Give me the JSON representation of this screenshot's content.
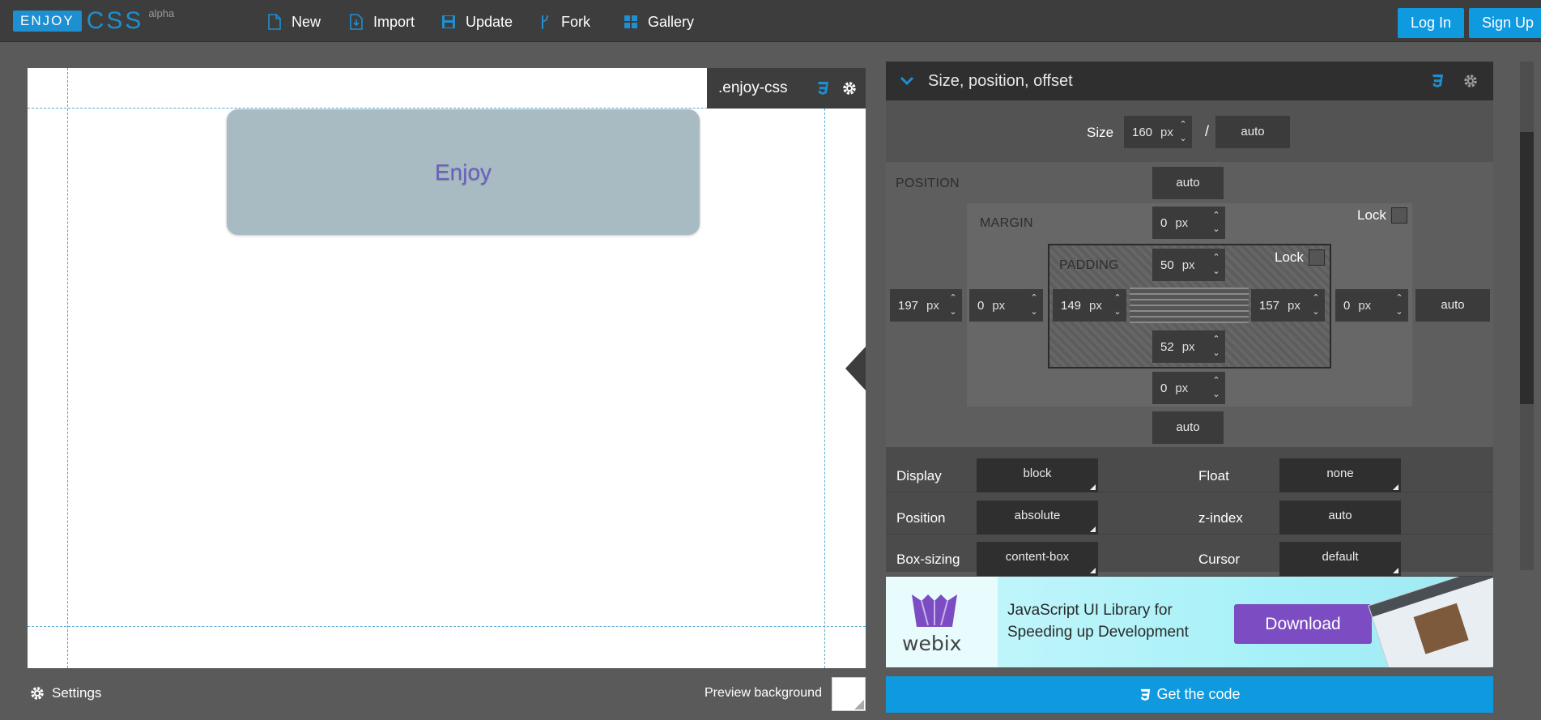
{
  "logo": {
    "enjoy": "ENJOY",
    "css": "CSS",
    "alpha": "alpha"
  },
  "nav": {
    "new": "New",
    "import": "Import",
    "update": "Update",
    "fork": "Fork",
    "gallery": "Gallery"
  },
  "auth": {
    "login": "Log In",
    "signup": "Sign Up"
  },
  "preview": {
    "class_name": ".enjoy-css",
    "element_text": "Enjoy"
  },
  "bottom": {
    "settings": "Settings",
    "preview_background": "Preview background",
    "get_code": "Get the code"
  },
  "panel": {
    "title": "Size, position, offset",
    "size": {
      "label": "Size",
      "width": "160",
      "width_unit": "px",
      "height": "auto",
      "separator": "/"
    },
    "position": {
      "label": "POSITION",
      "top": "auto",
      "bottom": "auto",
      "right": "auto",
      "left": "197",
      "left_unit": "px"
    },
    "margin": {
      "label": "MARGIN",
      "lock": "Lock",
      "top": "0",
      "bottom": "0",
      "left": "0",
      "right": "0",
      "unit": "px"
    },
    "padding": {
      "label": "PADDING",
      "lock": "Lock",
      "top": "50",
      "bottom": "52",
      "left": "149",
      "right": "157",
      "unit": "px"
    },
    "props": {
      "display_label": "Display",
      "display": "block",
      "float_label": "Float",
      "float": "none",
      "position_label": "Position",
      "position": "absolute",
      "zindex_label": "z-index",
      "zindex": "auto",
      "boxsizing_label": "Box-sizing",
      "boxsizing": "content-box",
      "cursor_label": "Cursor",
      "cursor": "default"
    }
  },
  "ad": {
    "brand": "webix",
    "line1": "JavaScript UI Library for",
    "line2": "Speeding up Development",
    "button": "Download"
  },
  "colors": {
    "accent": "#0f9ae0",
    "topbar": "#3d3d3d",
    "panel": "#4b4b4b",
    "ad_button": "#7c4cc2"
  }
}
